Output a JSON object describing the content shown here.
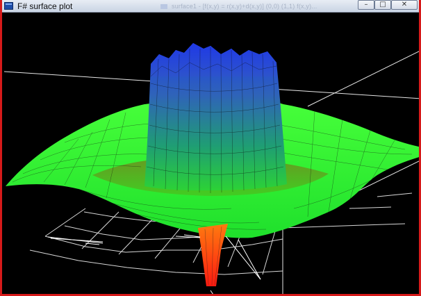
{
  "window": {
    "title": "F# surface plot",
    "background_window_text": "surface1 - [f(x,y) = r(x,y)+d(x,y)] (0,0) (1,1) f(x,y)...",
    "controls": {
      "minimize": "–",
      "maximize": "□",
      "close": "✕"
    },
    "colors": {
      "border": "#d61a1a",
      "plot_background": "#000000",
      "surface_high": "#2a3fd8",
      "surface_mid": "#27e02b",
      "surface_low": "#ff2a12",
      "mesh": "#ffffff"
    }
  }
}
